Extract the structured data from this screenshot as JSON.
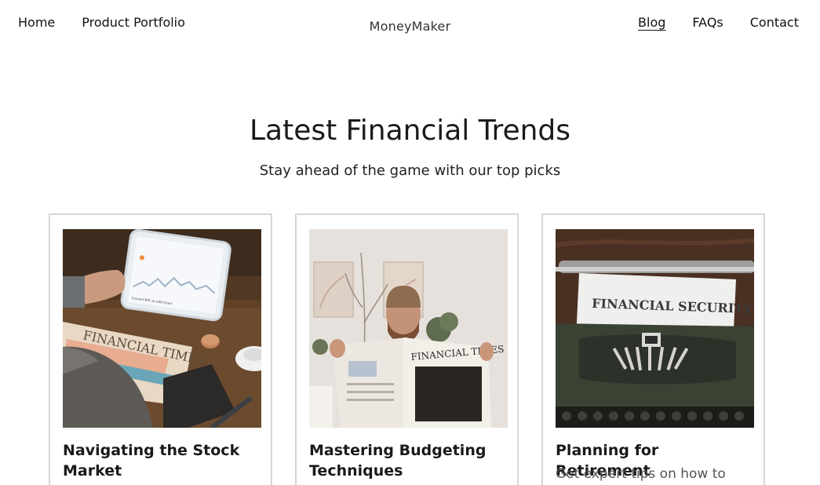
{
  "header": {
    "nav_left": [
      {
        "label": "Home"
      },
      {
        "label": "Product Portfolio"
      }
    ],
    "brand": "MoneyMaker",
    "nav_right": [
      {
        "label": "Blog",
        "active": true
      },
      {
        "label": "FAQs"
      },
      {
        "label": "Contact"
      }
    ]
  },
  "hero": {
    "title": "Latest Financial Trends",
    "subtitle": "Stay ahead of the game with our top picks"
  },
  "cards": [
    {
      "title": "Navigating the Stock Market",
      "description": "",
      "image_text": "FINANCIAL TIMES",
      "tablet_caption": "Convert BTC to USD Chart"
    },
    {
      "title": "Mastering Budgeting Techniques",
      "description": "",
      "image_text": "FINANCIAL TIMES"
    },
    {
      "title": "Planning for Retirement",
      "description": "Get expert tips on how to",
      "image_text": "FINANCIAL SECURITY"
    }
  ],
  "colors": {
    "card_border": "#d6d6d6",
    "text_primary": "#1a1a1a",
    "text_secondary": "#555555"
  }
}
